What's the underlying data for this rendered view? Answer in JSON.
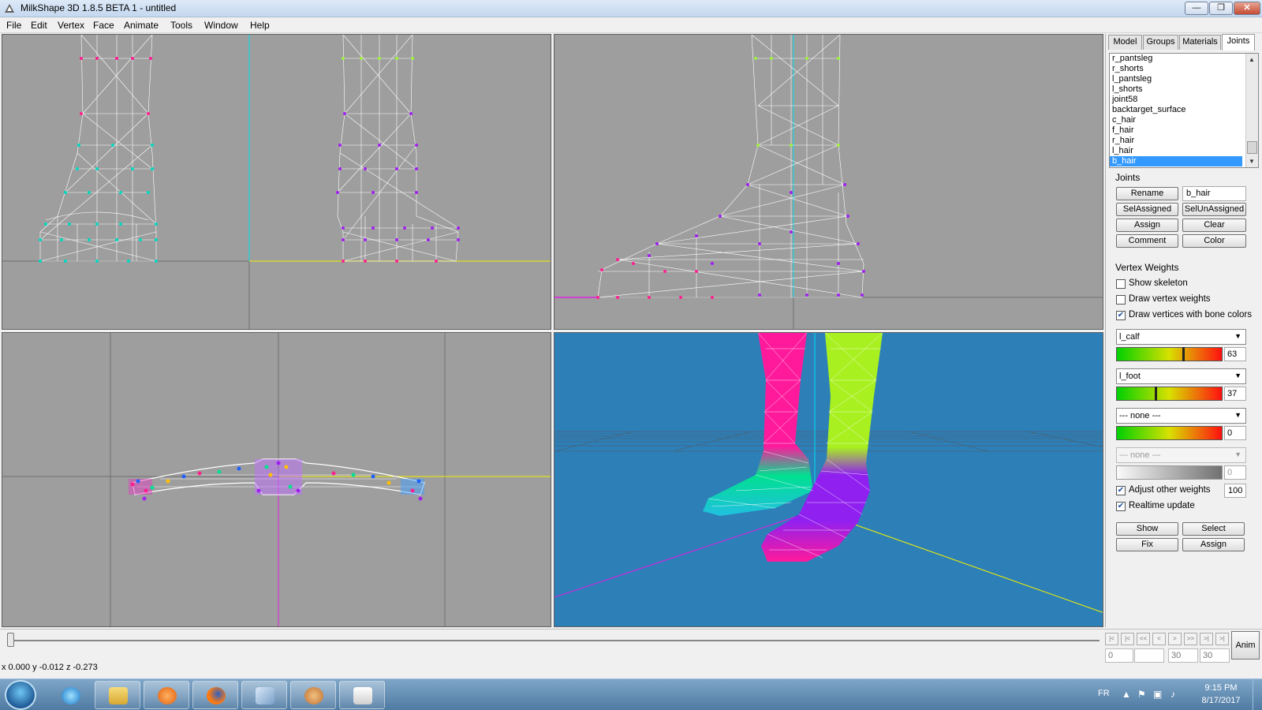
{
  "window": {
    "title": "MilkShape 3D 1.8.5 BETA 1 - untitled",
    "minimize": "—",
    "maximize": "❐",
    "close": "✕"
  },
  "menu": [
    "File",
    "Edit",
    "Vertex",
    "Face",
    "Animate",
    "Tools",
    "Window",
    "Help"
  ],
  "tabs": {
    "model": "Model",
    "groups": "Groups",
    "materials": "Materials",
    "joints": "Joints"
  },
  "joint_list": [
    "r_pantsleg",
    "r_shorts",
    "l_pantsleg",
    "l_shorts",
    "joint58",
    "backtarget_surface",
    "c_hair",
    "f_hair",
    "r_hair",
    "l_hair",
    "b_hair"
  ],
  "selected_joint": "b_hair",
  "joints": {
    "header": "Joints",
    "rename": "Rename",
    "name_value": "b_hair",
    "sel_assigned": "SelAssigned",
    "sel_unassigned": "SelUnAssigned",
    "assign": "Assign",
    "clear": "Clear",
    "comment": "Comment",
    "color": "Color"
  },
  "vertex_weights": {
    "header": "Vertex Weights",
    "show_skeleton": {
      "label": "Show skeleton",
      "checked": false
    },
    "draw_vertex_weights": {
      "label": "Draw vertex weights",
      "checked": false
    },
    "draw_bone_colors": {
      "label": "Draw vertices with bone colors",
      "checked": true
    },
    "weights": [
      {
        "bone": "l_calf",
        "value": "63",
        "level": 0.63,
        "enabled": true
      },
      {
        "bone": "l_foot",
        "value": "37",
        "level": 0.37,
        "enabled": true
      },
      {
        "bone": "--- none ---",
        "value": "0",
        "level": 0.0,
        "enabled": true
      },
      {
        "bone": "--- none ---",
        "value": "0",
        "level": 0.0,
        "enabled": false
      }
    ],
    "adjust_other": {
      "label": "Adjust other weights",
      "checked": true,
      "value": "100"
    },
    "realtime_update": {
      "label": "Realtime update",
      "checked": true
    },
    "show": "Show",
    "select": "Select",
    "fix": "Fix",
    "assign": "Assign"
  },
  "timeline": {
    "anim": "Anim",
    "frame_start": "0",
    "frame_current": "30",
    "frame_end": "30",
    "buttons": [
      "|<",
      "|<",
      "<<",
      "<",
      ">",
      ">>",
      ">|",
      ">|"
    ]
  },
  "status": {
    "coords": "x 0.000 y -0.012 z -0.273"
  },
  "taskbar": {
    "lang": "FR",
    "time": "9:15 PM",
    "date": "8/17/2017",
    "apps": [
      "internet-explorer",
      "file-explorer",
      "media-player",
      "firefox",
      "notepad",
      "paint",
      "milkshape"
    ]
  },
  "colors": {
    "viewport_bg": "#9e9e9e",
    "view3d_bg": "#2d7fb8",
    "mesh_line": "#ffffff",
    "calf_pink": "#ff1a9c",
    "calf_lime": "#a8f020",
    "foot_green": "#00e090",
    "foot_purple": "#9020f0",
    "axis_cyan": "#00e0f0",
    "axis_yellow": "#f0f000",
    "axis_magenta": "#e020e0",
    "selection_blue": "#3399ff"
  }
}
